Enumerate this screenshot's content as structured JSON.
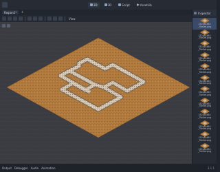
{
  "workspaces": {
    "items": [
      {
        "label": "2D"
      },
      {
        "label": "3D"
      },
      {
        "label": "Script"
      },
      {
        "label": "AssetLib"
      }
    ],
    "active": "2D"
  },
  "scene_tabs": [
    {
      "label": "Region1*"
    }
  ],
  "viewport_toolbar": {
    "view_label": "View"
  },
  "dock": {
    "title": "Inspector",
    "items": [
      {
        "name": "152x4x464 _TileSet.png"
      },
      {
        "name": "152x4x464 _TileSet.png"
      },
      {
        "name": "152x4x464 _TileSet.png"
      },
      {
        "name": "152x4x464 _TileSet.png"
      },
      {
        "name": "152x4x464 _TileSet.png"
      },
      {
        "name": "152x4x464 _TileSet.png"
      },
      {
        "name": "152x4x464 _TileSet.png"
      },
      {
        "name": "152x4x464 _TileSet.png"
      },
      {
        "name": "152x4x464 _TileSet.png"
      },
      {
        "name": "152x4x464 _TileSet.png"
      },
      {
        "name": "152x4x464 _TileSet.png"
      },
      {
        "name": "152x4x464 _TileSet.png"
      }
    ],
    "selected_index": 0
  },
  "bottom_panel": {
    "tabs": [
      {
        "label": "Output"
      },
      {
        "label": "Debugger"
      },
      {
        "label": "Audio"
      },
      {
        "label": "Animation"
      }
    ],
    "version": "3.1.1"
  },
  "colors": {
    "ground": "#b07a3e",
    "path": "#c9b9a4",
    "grid": "#5a5a66"
  }
}
